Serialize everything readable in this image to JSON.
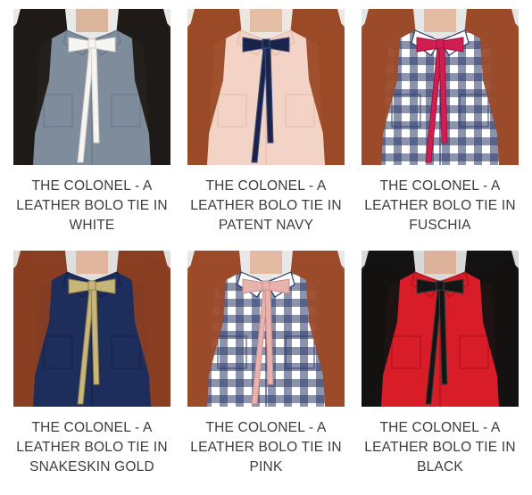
{
  "products": [
    {
      "lines": [
        "THE COLONEL - A",
        "LEATHER BOLO TIE IN",
        "WHITE"
      ],
      "colors": {
        "bg": "#e9e9e9",
        "shirt": "#7f8c9c",
        "shirt_dark": "#697688",
        "hair": "#1f1a17",
        "skin": "#dcb59d",
        "tie": "#f6f5f2",
        "tie_edge": "#d6d3cc",
        "plaid": false
      }
    },
    {
      "lines": [
        "THE COLONEL - A",
        "LEATHER BOLO TIE IN",
        "PATENT NAVY"
      ],
      "colors": {
        "bg": "#ede7e2",
        "shirt": "#f2d3c5",
        "shirt_dark": "#e2bcab",
        "hair": "#9a4a26",
        "skin": "#e5bea6",
        "tie": "#1b2448",
        "tie_edge": "#3c4f86",
        "plaid": false
      }
    },
    {
      "lines": [
        "THE COLONEL - A",
        "LEATHER BOLO TIE IN",
        "FUSCHIA"
      ],
      "colors": {
        "bg": "#e6e6e6",
        "shirt": "#ffffff",
        "shirt_dark": "#2e3a6a",
        "hair": "#9b4a2a",
        "skin": "#e4bca4",
        "tie": "#d11e52",
        "tie_edge": "#a0143c",
        "plaid": true
      }
    },
    {
      "lines": [
        "THE COLONEL - A",
        "LEATHER BOLO TIE IN",
        "SNAKESKIN GOLD"
      ],
      "colors": {
        "bg": "#dfdfdf",
        "shirt": "#1d2d5c",
        "shirt_dark": "#132146",
        "hair": "#8a3e22",
        "skin": "#e2b69d",
        "tie": "#c7b57a",
        "tie_edge": "#8f7d45",
        "plaid": false
      }
    },
    {
      "lines": [
        "THE COLONEL - A",
        "LEATHER BOLO TIE IN",
        "PINK"
      ],
      "colors": {
        "bg": "#e8e8e8",
        "shirt": "#ffffff",
        "shirt_dark": "#2e3a6a",
        "hair": "#9b4a2a",
        "skin": "#e3bba2",
        "tie": "#e8b3ae",
        "tie_edge": "#c98f8a",
        "plaid": true
      }
    },
    {
      "lines": [
        "THE COLONEL - A",
        "LEATHER BOLO TIE IN",
        "BLACK"
      ],
      "colors": {
        "bg": "#d9d9d9",
        "shirt": "#d81d28",
        "shirt_dark": "#a8121b",
        "hair": "#141212",
        "skin": "#ddb29a",
        "tie": "#151515",
        "tie_edge": "#3e3e3e",
        "plaid": false
      }
    }
  ]
}
